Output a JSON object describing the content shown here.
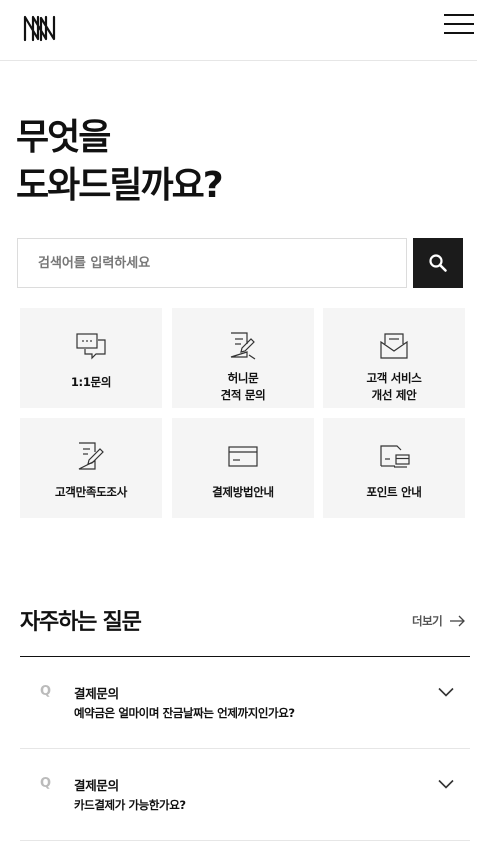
{
  "header": {
    "logo_icon": "n-logo-icon",
    "menu_icon": "hamburger-menu-icon"
  },
  "hero": {
    "title_line1": "무엇을",
    "title_line2": "도와드릴까요?"
  },
  "search": {
    "placeholder": "검색어를 입력하세요",
    "value": "",
    "button_icon": "search-icon"
  },
  "services": [
    {
      "label": "1:1문의",
      "icon": "chat-bubbles-icon"
    },
    {
      "label": "허니문\n견적 문의",
      "icon": "document-pen-icon"
    },
    {
      "label": "고객 서비스\n개선 제안",
      "icon": "open-envelope-icon"
    },
    {
      "label": "고객만족도조사",
      "icon": "clipboard-pen-icon"
    },
    {
      "label": "결제방법안내",
      "icon": "credit-card-icon"
    },
    {
      "label": "포인트 안내",
      "icon": "folder-card-icon"
    }
  ],
  "faq": {
    "title": "자주하는 질문",
    "more_label": "더보기",
    "more_icon": "arrow-right-icon",
    "items": [
      {
        "marker": "Q",
        "category": "결제문의",
        "question": "예약금은 얼마이며 잔금날짜는 언제까지인가요?",
        "icon": "chevron-down-icon"
      },
      {
        "marker": "Q",
        "category": "결제문의",
        "question": "카드결제가 가능한가요?",
        "icon": "chevron-down-icon"
      }
    ]
  },
  "colors": {
    "text": "#111111",
    "tile_bg": "#f5f5f5",
    "search_button": "#1b1b1b",
    "muted": "#bbbbbb"
  }
}
